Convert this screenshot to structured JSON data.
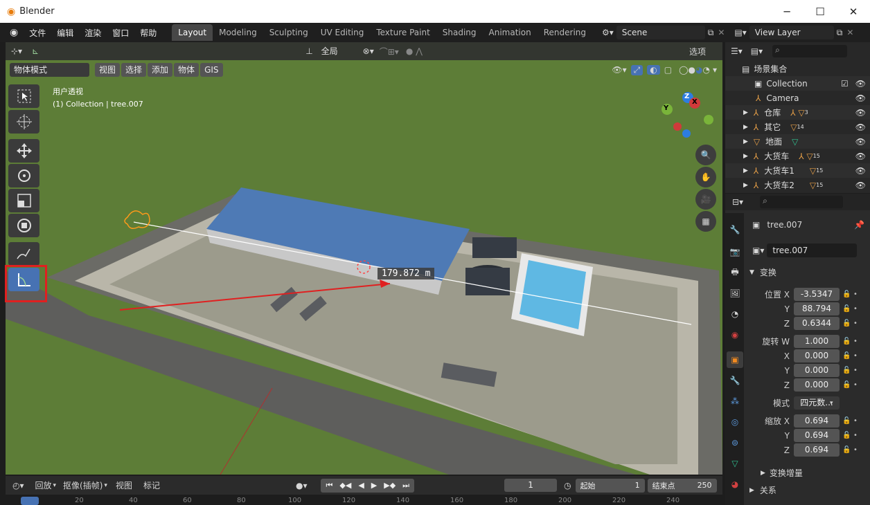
{
  "window": {
    "title": "Blender",
    "min": "─",
    "max": "☐",
    "close": "✕"
  },
  "menu": [
    "文件",
    "编辑",
    "渲染",
    "窗口",
    "帮助"
  ],
  "workspace_tabs": [
    "Layout",
    "Modeling",
    "Sculpting",
    "UV Editing",
    "Texture Paint",
    "Shading",
    "Animation",
    "Rendering"
  ],
  "scene_name": "Scene",
  "view_layer": "View Layer",
  "viewport": {
    "transform_orientation": "全局",
    "options_label": "选项",
    "mode": "物体模式",
    "menus": [
      "视图",
      "选择",
      "添加",
      "物体",
      "GIS"
    ],
    "overlay_title": "用户透视",
    "overlay_subtitle": "(1) Collection | tree.007",
    "measure_value": "179.872 m",
    "gizmo_axes": {
      "z": "Z",
      "y": "Y",
      "x": "X"
    }
  },
  "outliner": {
    "root": "场景集合",
    "items": [
      {
        "label": "Collection",
        "indent": 0
      },
      {
        "label": "Camera",
        "indent": 1
      },
      {
        "label": "仓库",
        "indent": 1,
        "count": "3"
      },
      {
        "label": "其它",
        "indent": 1,
        "count": "14"
      },
      {
        "label": "地面",
        "indent": 1,
        "count": ""
      },
      {
        "label": "大货车",
        "indent": 1,
        "count": "15"
      },
      {
        "label": "大货车1",
        "indent": 1,
        "count": "15"
      },
      {
        "label": "大货车2",
        "indent": 1,
        "count": "15"
      }
    ]
  },
  "properties": {
    "object_name": "tree.007",
    "data_name": "tree.007",
    "transform_header": "变换",
    "location_label": "位置 X",
    "location": {
      "x": "-3.5347",
      "y": "88.794",
      "z": "0.6344"
    },
    "rotation_label": "旋转 W",
    "rotation": {
      "w": "1.000",
      "x": "0.000",
      "y": "0.000",
      "z": "0.000"
    },
    "mode_label": "模式",
    "mode_value": "四元数...",
    "scale_label": "缩放 X",
    "scale": {
      "x": "0.694",
      "y": "0.694",
      "z": "0.694"
    },
    "delta_header": "变换增量",
    "relations_header": "关系",
    "axis_y": "Y",
    "axis_z": "Z",
    "axis_x": "X"
  },
  "timeline": {
    "playback": "回放",
    "keying": "抠像(插帧)",
    "view": "视图",
    "marker": "标记",
    "current_frame": "1",
    "start_label": "起始",
    "start_value": "1",
    "end_label": "结束点",
    "end_value": "250",
    "ruler_ticks": [
      "20",
      "40",
      "60",
      "80",
      "100",
      "120",
      "140",
      "160",
      "180",
      "200",
      "220",
      "240"
    ]
  },
  "colors": {
    "accent": "#4772b3",
    "highlight_box": "#e02020",
    "viewport_bg": "#5a7a34"
  }
}
